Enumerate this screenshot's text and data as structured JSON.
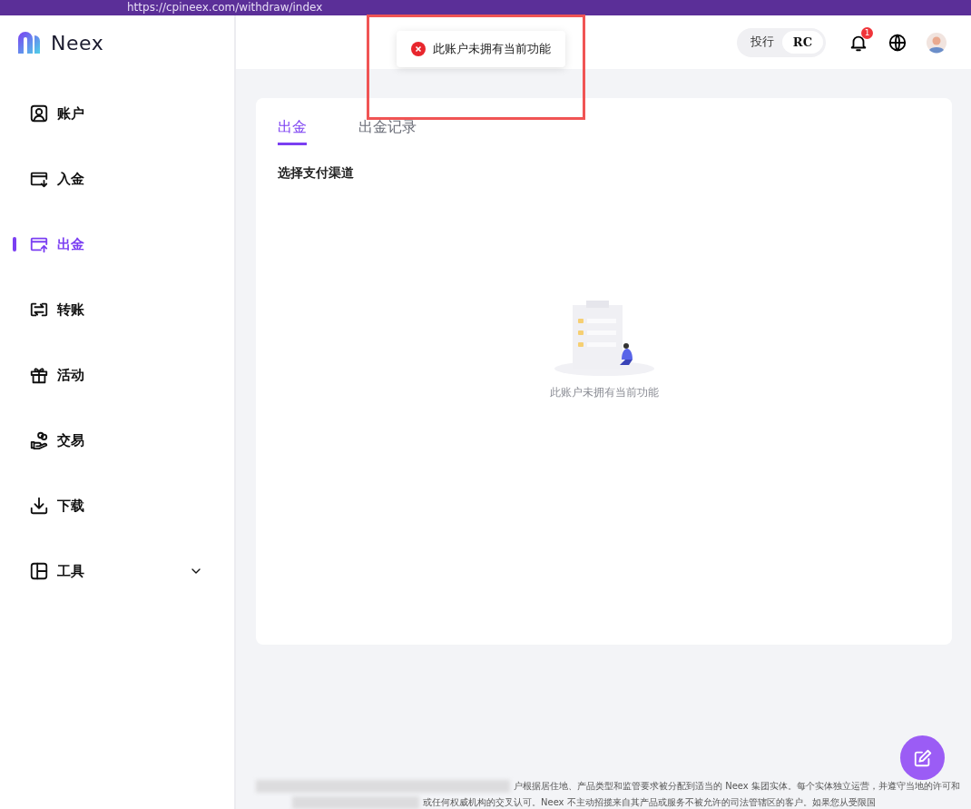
{
  "browser": {
    "url": "https://cpineex.com/withdraw/index"
  },
  "logo": {
    "text": "Neex"
  },
  "sidebar": {
    "items": [
      {
        "label": "账户",
        "kind": "account",
        "selected": false
      },
      {
        "label": "入金",
        "kind": "deposit",
        "selected": false
      },
      {
        "label": "出金",
        "kind": "withdraw",
        "selected": true
      },
      {
        "label": "转账",
        "kind": "transfer",
        "selected": false
      },
      {
        "label": "活动",
        "kind": "gift",
        "selected": false
      },
      {
        "label": "交易",
        "kind": "trade",
        "selected": false
      },
      {
        "label": "下载",
        "kind": "download",
        "selected": false
      },
      {
        "label": "工具",
        "kind": "tools",
        "selected": false,
        "expandable": true
      }
    ]
  },
  "header": {
    "toggle": {
      "left": "投行",
      "right": "RC"
    },
    "notification_count": "1"
  },
  "toast": {
    "message": "此账户未拥有当前功能"
  },
  "tabs": [
    {
      "label": "出金",
      "selected": true
    },
    {
      "label": "出金记录",
      "selected": false
    }
  ],
  "section_title": "选择支付渠道",
  "empty_state": {
    "message": "此账户未拥有当前功能"
  },
  "footer": {
    "lines": [
      "户根据居住地、产品类型和监管要求被分配到适当的 Neex 集团实体。每个实体独立运营，并遵守当地的许可和",
      "或任何权威机构的交叉认可。Neex 不主动招揽来自其产品或服务不被允许的司法管辖区的客户。如果您从受限国"
    ]
  }
}
